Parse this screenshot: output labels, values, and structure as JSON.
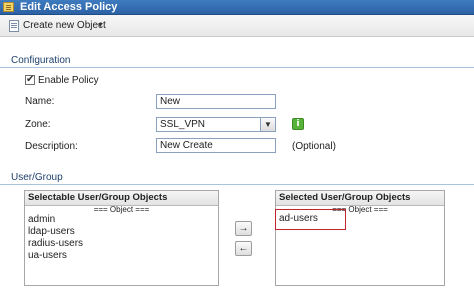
{
  "window": {
    "title": "Edit Access Policy"
  },
  "toolbar": {
    "create_label": "Create new Object"
  },
  "configuration": {
    "header": "Configuration",
    "enable_label": "Enable Policy",
    "enable_checked": true,
    "name_label": "Name:",
    "name_value": "New",
    "zone_label": "Zone:",
    "zone_value": "SSL_VPN",
    "description_label": "Description:",
    "description_value": "New Create",
    "optional_label": "(Optional)"
  },
  "user_group": {
    "header": "User/Group",
    "selectable": {
      "title": "Selectable User/Group Objects",
      "subheader": "=== Object ===",
      "items": [
        "admin",
        "ldap-users",
        "radius-users",
        "ua-users"
      ]
    },
    "selected": {
      "title": "Selected User/Group Objects",
      "subheader": "=== Object ===",
      "items": [
        "ad-users"
      ]
    },
    "move_right": "→",
    "move_left": "←"
  },
  "colors": {
    "title_bar": "#2c62a4",
    "highlight": "#c0262c",
    "info_icon": "#58b33b"
  },
  "icons": [
    "folder-icon",
    "new-object-icon",
    "chevron-down-icon",
    "info-icon",
    "arrow-right-icon",
    "arrow-left-icon"
  ]
}
